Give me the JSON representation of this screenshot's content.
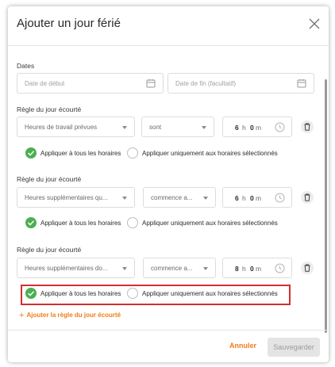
{
  "dialog": {
    "title": "Ajouter un jour férié",
    "dates_label": "Dates",
    "start_date_placeholder": "Date de début",
    "end_date_placeholder": "Date de fin (facultatif)"
  },
  "rules": [
    {
      "label": "Règle du jour écourté",
      "type_value": "Heures de travail prévues",
      "condition_value": "sont",
      "hours": "6",
      "hours_unit": "h",
      "minutes": "0",
      "minutes_unit": "m",
      "apply_all": "Appliquer à tous les horaires",
      "apply_selected": "Appliquer uniquement aux horaires sélectionnés",
      "selected_option": "all"
    },
    {
      "label": "Règle du jour écourté",
      "type_value": "Heures supplémentaires qu...",
      "condition_value": "commence a...",
      "hours": "6",
      "hours_unit": "h",
      "minutes": "0",
      "minutes_unit": "m",
      "apply_all": "Appliquer à tous les horaires",
      "apply_selected": "Appliquer uniquement aux horaires sélectionnés",
      "selected_option": "all"
    },
    {
      "label": "Règle du jour écourté",
      "type_value": "Heures supplémentaires do...",
      "condition_value": "commence a...",
      "hours": "8",
      "hours_unit": "h",
      "minutes": "0",
      "minutes_unit": "m",
      "apply_all": "Appliquer à tous les horaires",
      "apply_selected": "Appliquer uniquement aux horaires sélectionnés",
      "selected_option": "all"
    }
  ],
  "add_rule_label": "Ajouter la règle du jour écourté",
  "footer": {
    "cancel_label": "Annuler",
    "save_label": "Sauvegarder"
  },
  "colors": {
    "accent": "#ef7d17",
    "radio_selected": "#4caf50",
    "highlight": "#d32f2f",
    "disabled_bg": "#e4e4e4"
  },
  "icons": {
    "close": "close-icon",
    "calendar": "calendar-icon",
    "clock": "clock-icon",
    "trash": "trash-icon",
    "dropdown": "chevron-down-icon",
    "radio_checked": "check-circle-icon",
    "add": "plus-icon"
  }
}
